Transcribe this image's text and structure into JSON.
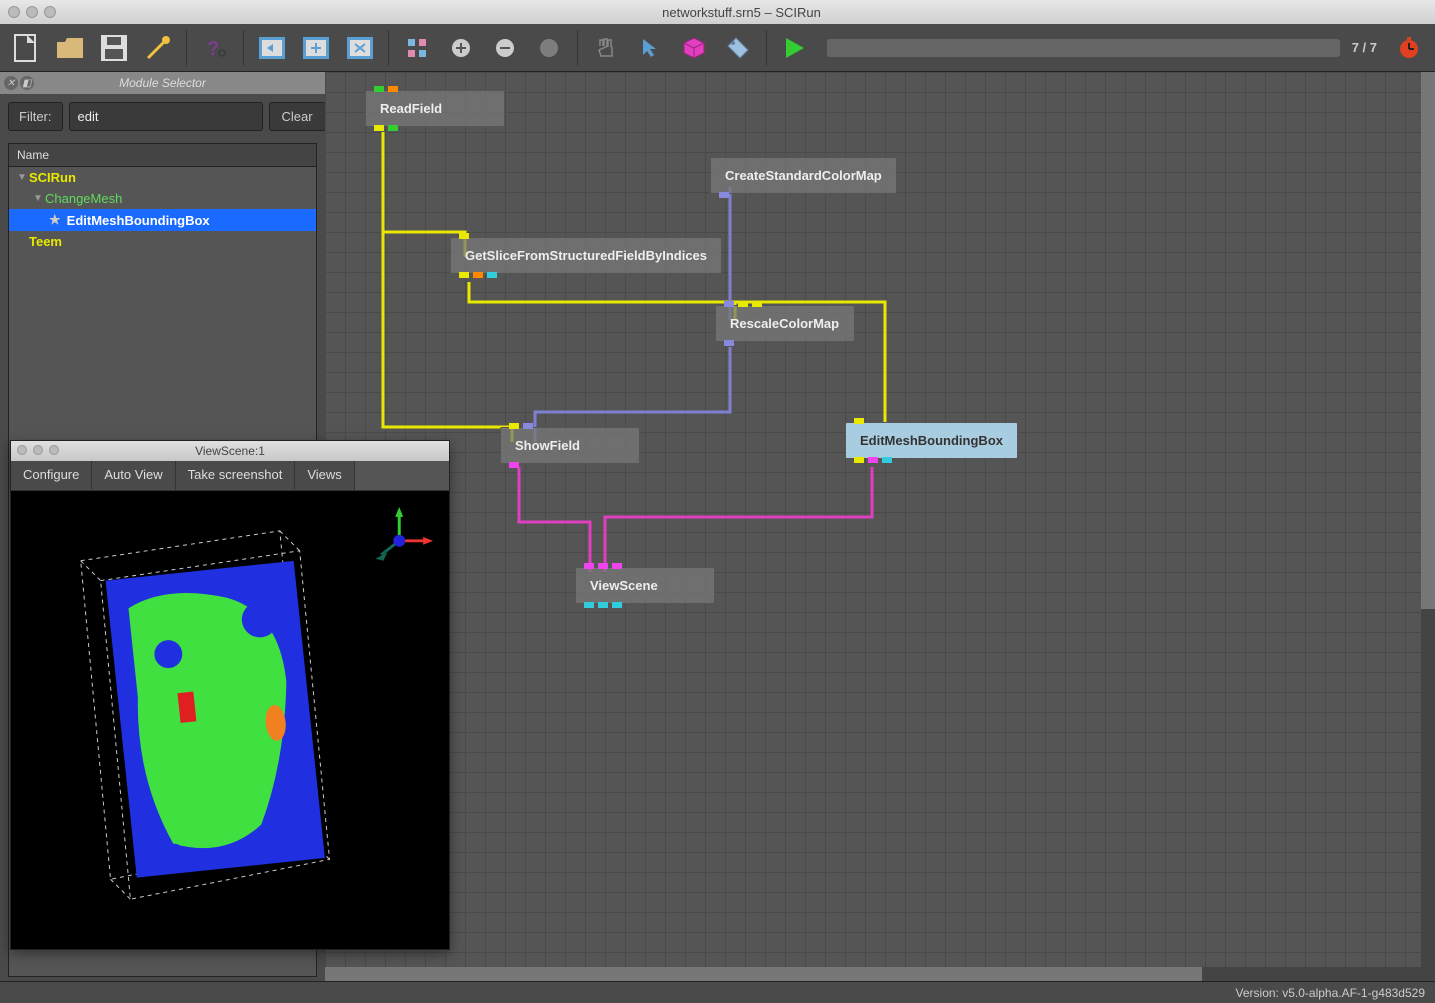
{
  "window": {
    "title": "networkstuff.srn5 – SCIRun"
  },
  "toolbar": {
    "progress": "7 / 7"
  },
  "sidebar": {
    "title": "Module Selector",
    "filter_label": "Filter:",
    "filter_value": "edit",
    "clear_label": "Clear",
    "tree_header": "Name",
    "items": {
      "root": "SCIRun",
      "change_mesh": "ChangeMesh",
      "edit_mesh": "EditMeshBoundingBox",
      "teem": "Teem"
    }
  },
  "modules": {
    "read_field": "ReadField",
    "get_slice": "GetSliceFromStructuredFieldByIndices",
    "create_cm": "CreateStandardColorMap",
    "rescale_cm": "RescaleColorMap",
    "show_field": "ShowField",
    "edit_mesh_bb": "EditMeshBoundingBox",
    "view_scene": "ViewScene"
  },
  "viewscene": {
    "title": "ViewScene:1",
    "buttons": {
      "configure": "Configure",
      "auto_view": "Auto View",
      "screenshot": "Take screenshot",
      "views": "Views"
    }
  },
  "status": {
    "version": "Version: v5.0-alpha.AF-1-g483d529"
  }
}
